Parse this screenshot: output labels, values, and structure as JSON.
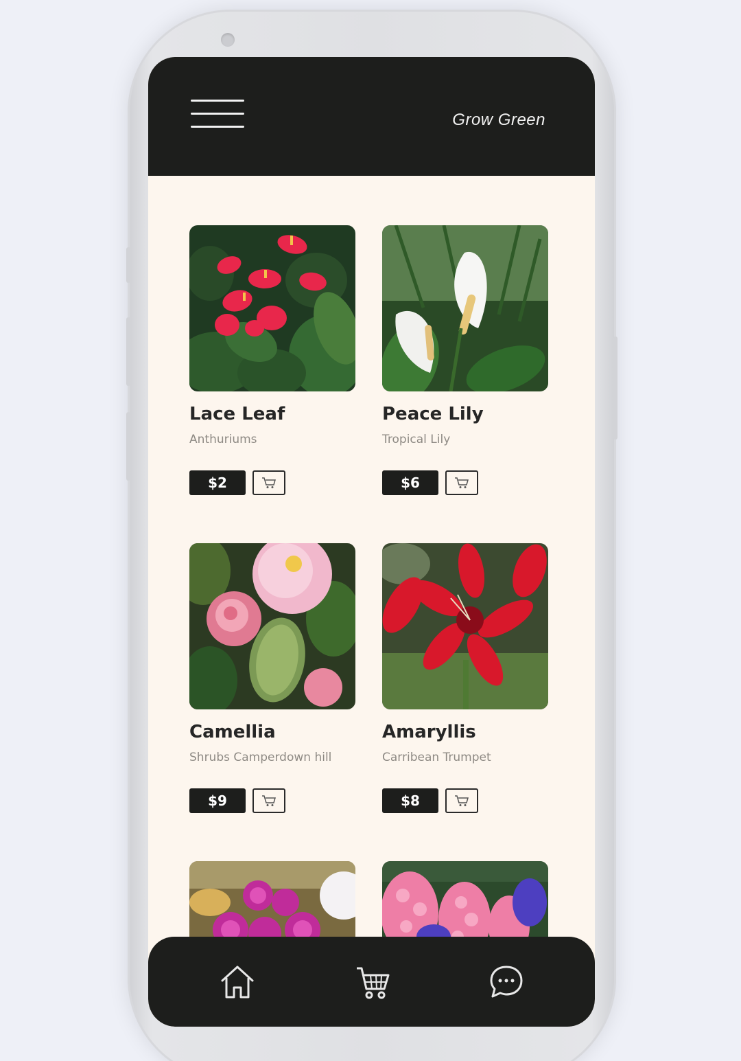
{
  "app": {
    "brand": "Grow Green"
  },
  "header": {
    "menu_icon": "hamburger-menu-icon"
  },
  "products": [
    {
      "name": "Lace Leaf",
      "subtitle": "Anthuriums",
      "price": "$2",
      "image": "red-anthurium-photo"
    },
    {
      "name": "Peace Lily",
      "subtitle": "Tropical Lily",
      "price": "$6",
      "image": "white-peace-lily-photo"
    },
    {
      "name": "Camellia",
      "subtitle": "Shrubs Camperdown hill",
      "price": "$9",
      "image": "pink-camellia-photo"
    },
    {
      "name": "Amaryllis",
      "subtitle": "Carribean Trumpet",
      "price": "$8",
      "image": "red-amaryllis-photo"
    },
    {
      "name": "",
      "subtitle": "",
      "price": "",
      "image": "magenta-orchid-photo"
    },
    {
      "name": "",
      "subtitle": "",
      "price": "",
      "image": "pink-hyacinth-photo"
    }
  ],
  "nav": {
    "icons": [
      "home-icon",
      "cart-icon",
      "chat-icon"
    ]
  },
  "colors": {
    "dark": "#1d1e1c",
    "background": "#fdf6ee",
    "text": "#262626",
    "muted": "#8e8a84"
  }
}
